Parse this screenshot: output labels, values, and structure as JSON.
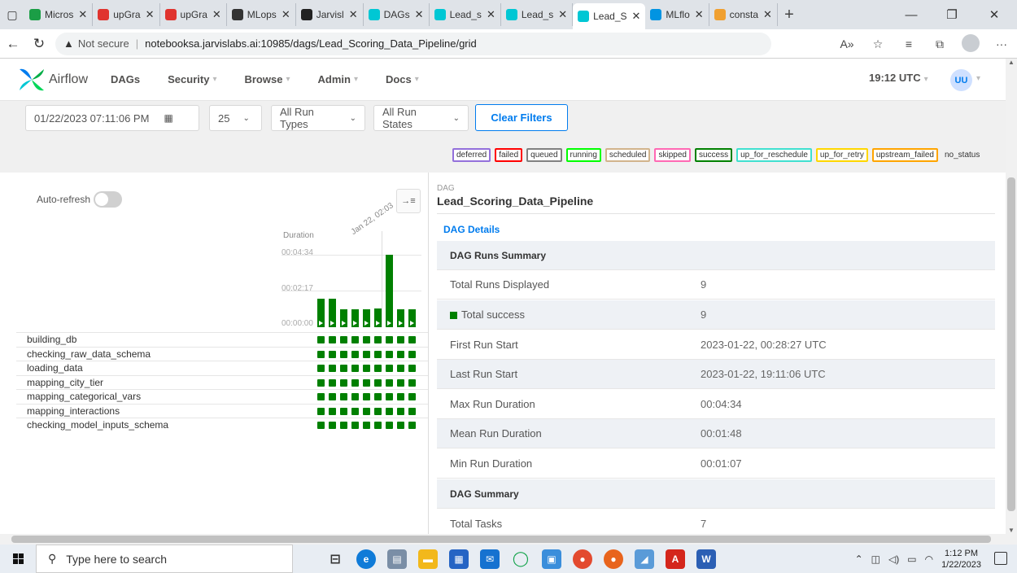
{
  "browser": {
    "tabs": [
      {
        "label": "Micros",
        "icon": "microsoft-icon",
        "color": "#1b9e46"
      },
      {
        "label": "upGra",
        "icon": "upgrad-icon",
        "color": "#e0342f"
      },
      {
        "label": "upGra",
        "icon": "upgrad-icon",
        "color": "#e0342f"
      },
      {
        "label": "MLops",
        "icon": "github-icon",
        "color": "#333333"
      },
      {
        "label": "Jarvisl",
        "icon": "jarvislabs-icon",
        "color": "#222222"
      },
      {
        "label": "DAGs",
        "icon": "airflow-icon",
        "color": "#00c7d4"
      },
      {
        "label": "Lead_s",
        "icon": "airflow-icon",
        "color": "#00c7d4"
      },
      {
        "label": "Lead_s",
        "icon": "airflow-icon",
        "color": "#00c7d4"
      },
      {
        "label": "Lead_S",
        "icon": "airflow-icon",
        "color": "#00c7d4",
        "active": true
      },
      {
        "label": "MLflo",
        "icon": "mlflow-icon",
        "color": "#0194e2"
      },
      {
        "label": "consta",
        "icon": "loading-icon",
        "color": "#f0a030"
      }
    ],
    "not_secure": "Not secure",
    "url": "notebooksa.jarvislabs.ai:10985/dags/Lead_Scoring_Data_Pipeline/grid"
  },
  "airflow": {
    "brand": "Airflow",
    "menu": [
      "DAGs",
      "Security",
      "Browse",
      "Admin",
      "Docs"
    ],
    "time": "19:12 UTC",
    "user_initials": "UU"
  },
  "filters": {
    "base_date": "01/22/2023 07:11:06 PM",
    "num_runs": "25",
    "run_types": "All Run Types",
    "run_states": "All Run States",
    "clear_label": "Clear Filters"
  },
  "legend": [
    {
      "label": "deferred",
      "color": "#9370db"
    },
    {
      "label": "failed",
      "color": "#ff0000"
    },
    {
      "label": "queued",
      "color": "#808080"
    },
    {
      "label": "running",
      "color": "#00ff00"
    },
    {
      "label": "scheduled",
      "color": "#d2b48c"
    },
    {
      "label": "skipped",
      "color": "#ff69b4"
    },
    {
      "label": "success",
      "color": "#008000"
    },
    {
      "label": "up_for_reschedule",
      "color": "#40e0d0"
    },
    {
      "label": "up_for_retry",
      "color": "#ffd700"
    },
    {
      "label": "upstream_failed",
      "color": "#ffa500"
    },
    {
      "label": "no_status",
      "color": null
    }
  ],
  "grid": {
    "auto_refresh_label": "Auto-refresh",
    "duration_label": "Duration",
    "y_ticks": [
      "00:04:34",
      "00:02:17",
      "00:00:00"
    ],
    "date_label": "Jan 22, 02:03",
    "run_durations_sec": [
      108,
      108,
      67,
      67,
      67,
      72,
      274,
      67,
      67
    ],
    "max_duration_sec": 274,
    "tasks": [
      "building_db",
      "checking_raw_data_schema",
      "loading_data",
      "mapping_city_tier",
      "mapping_categorical_vars",
      "mapping_interactions",
      "checking_model_inputs_schema"
    ],
    "runs_count": 9
  },
  "details": {
    "dag_label": "DAG",
    "dag_id": "Lead_Scoring_Data_Pipeline",
    "tab": "DAG Details",
    "runs_summary_header": "DAG Runs Summary",
    "rows": [
      {
        "k": "Total Runs Displayed",
        "v": "9"
      },
      {
        "k": "Total success",
        "v": "9"
      },
      {
        "k": "First Run Start",
        "v": "2023-01-22, 00:28:27 UTC"
      },
      {
        "k": "Last Run Start",
        "v": "2023-01-22, 19:11:06 UTC"
      },
      {
        "k": "Max Run Duration",
        "v": "00:04:34"
      },
      {
        "k": "Mean Run Duration",
        "v": "00:01:48"
      },
      {
        "k": "Min Run Duration",
        "v": "00:01:07"
      }
    ],
    "dag_summary_header": "DAG Summary",
    "total_tasks_label": "Total Tasks",
    "total_tasks": "7"
  },
  "taskbar": {
    "search_placeholder": "Type here to search",
    "time": "1:12 PM",
    "date": "1/22/2023"
  }
}
